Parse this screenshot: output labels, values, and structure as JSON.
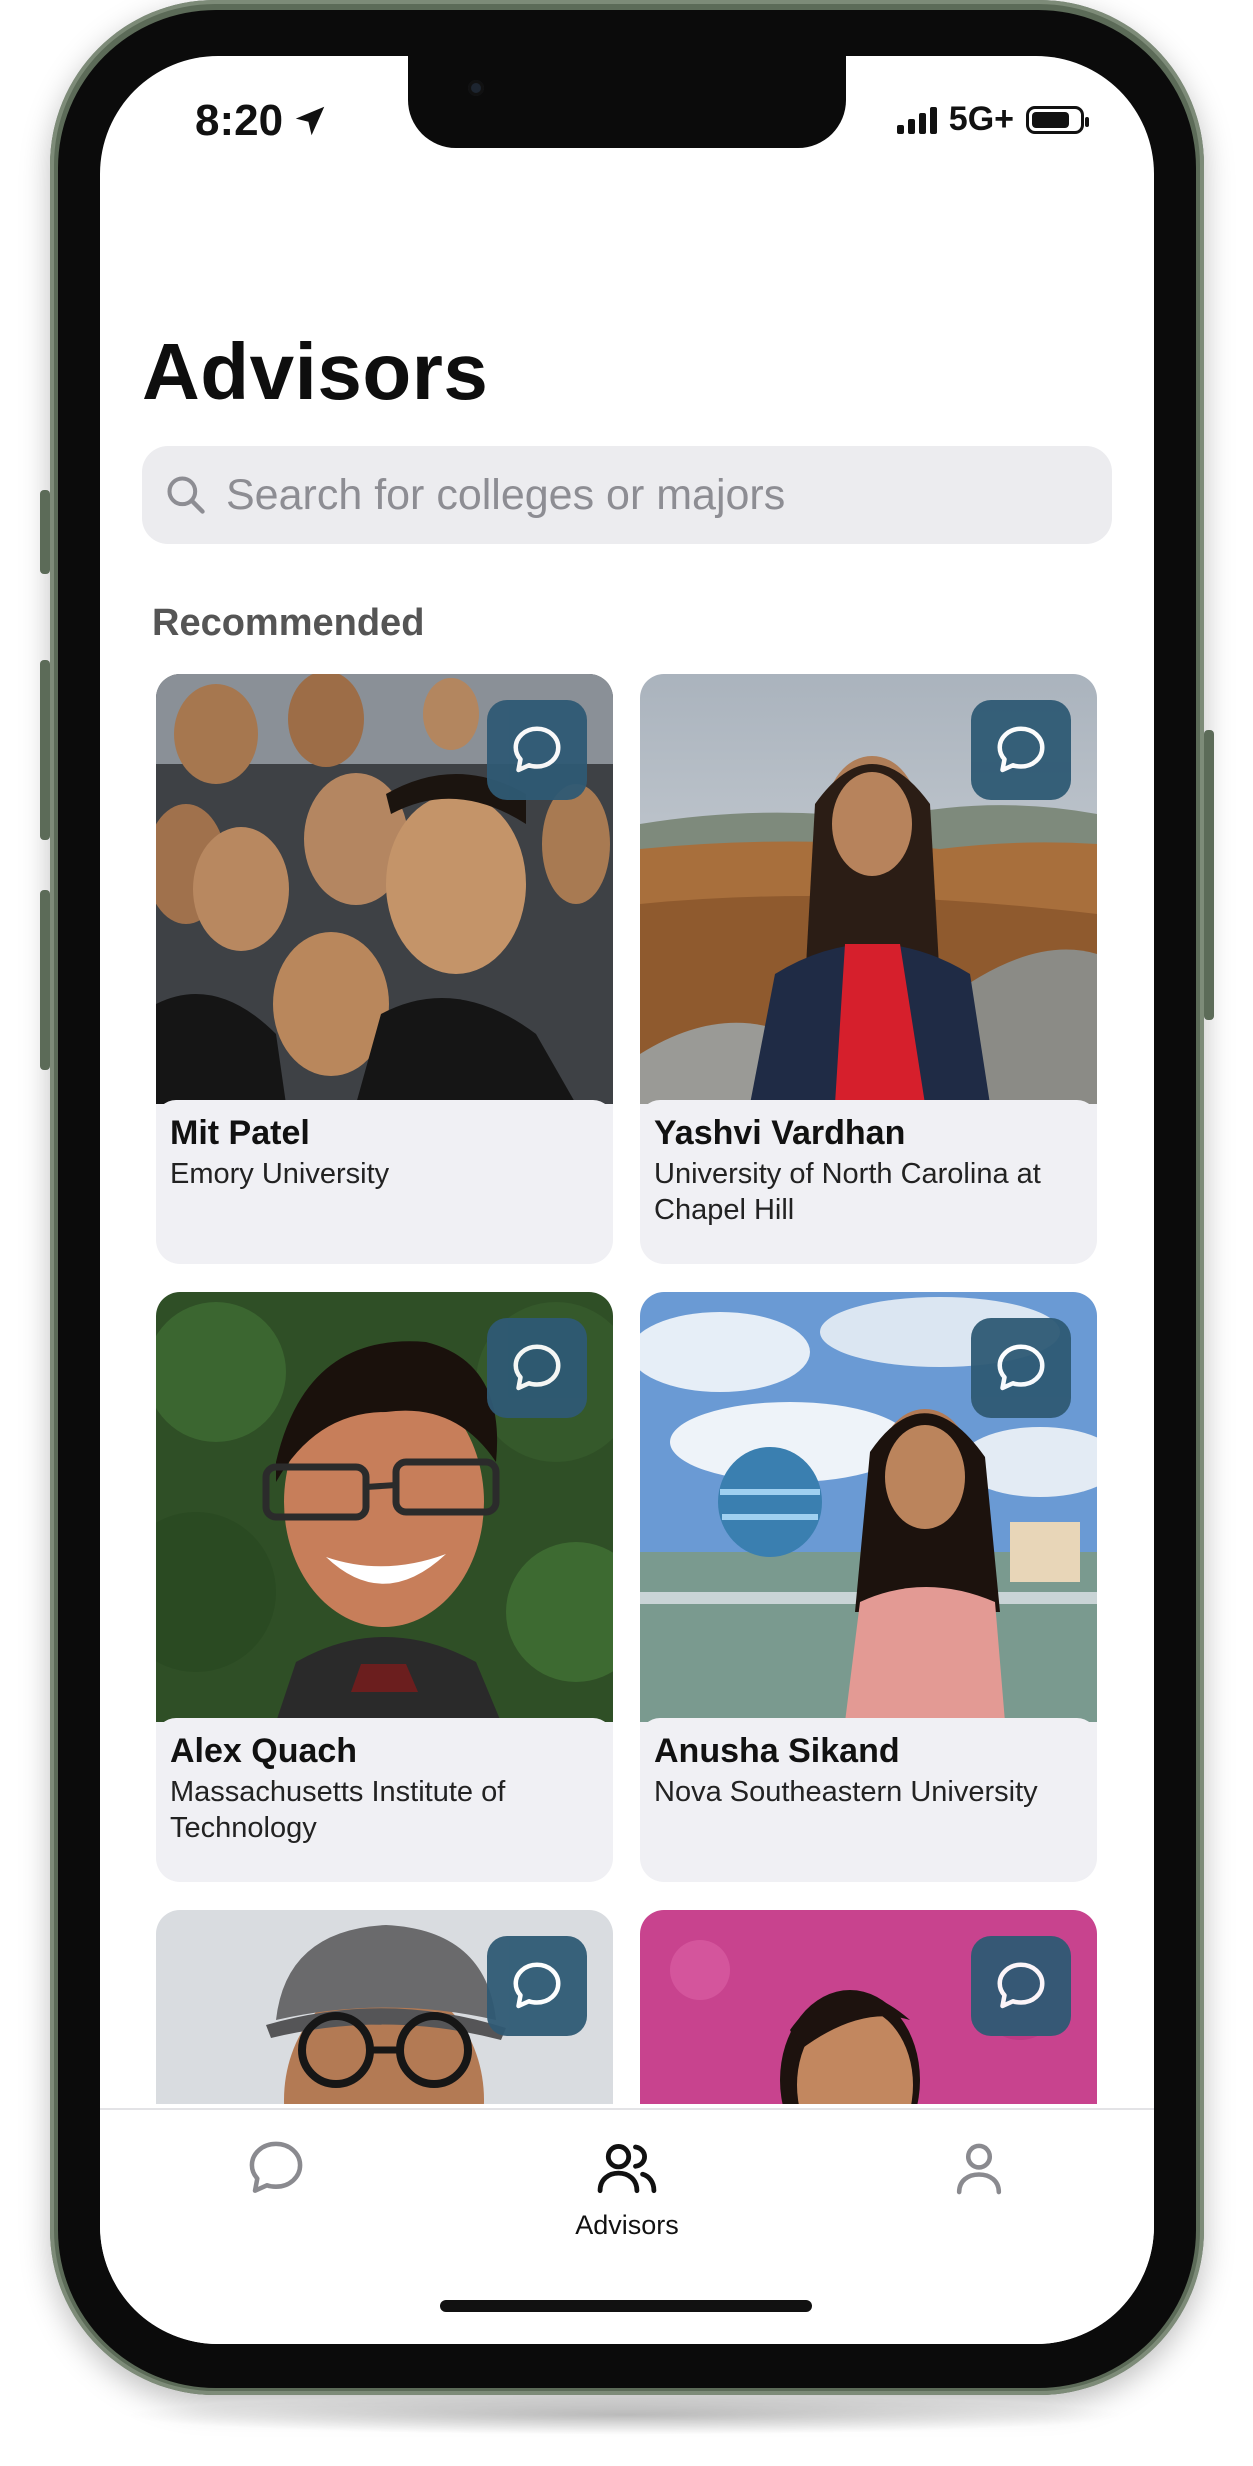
{
  "status_bar": {
    "time": "8:20",
    "network": "5G+",
    "battery_level": 0.8
  },
  "header": {
    "title": "Advisors"
  },
  "search": {
    "placeholder": "Search for colleges or majors"
  },
  "section": {
    "label": "Recommended"
  },
  "advisors": [
    {
      "name": "Mit Patel",
      "school": "Emory University"
    },
    {
      "name": "Yashvi Vardhan",
      "school": "University of North Carolina at Chapel Hill"
    },
    {
      "name": "Alex Quach",
      "school": "Massachusetts Institute of Technology"
    },
    {
      "name": "Anusha Sikand",
      "school": "Nova Southeastern University"
    },
    {
      "name": "",
      "school": ""
    },
    {
      "name": "",
      "school": ""
    }
  ],
  "tabbar": {
    "chats_icon": "chat-bubble-icon",
    "advisors_label": "Advisors",
    "advisors_icon": "people-icon",
    "profile_icon": "person-icon"
  },
  "colors": {
    "accent": "#2f5a74",
    "card_bg": "#f0f0f4",
    "frame": "#5c6b58"
  }
}
